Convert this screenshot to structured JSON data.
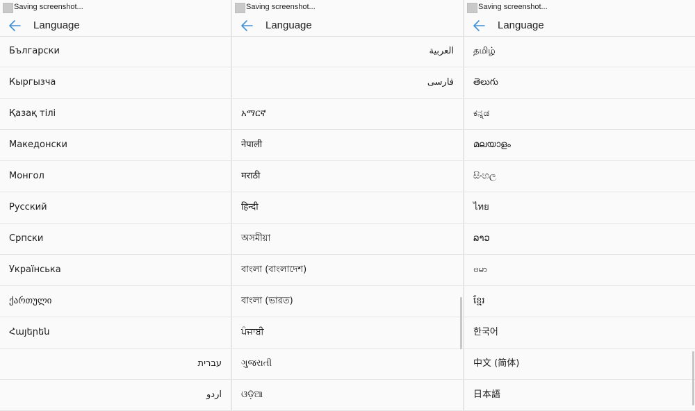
{
  "panels": [
    {
      "status_text": "Saving screenshot...",
      "title": "Language",
      "items": [
        {
          "label": "Български",
          "rtl": false
        },
        {
          "label": "Кыргызча",
          "rtl": false
        },
        {
          "label": "Қазақ тілі",
          "rtl": false
        },
        {
          "label": "Македонски",
          "rtl": false
        },
        {
          "label": "Монгол",
          "rtl": false
        },
        {
          "label": "Русский",
          "rtl": false
        },
        {
          "label": "Српски",
          "rtl": false
        },
        {
          "label": "Українська",
          "rtl": false
        },
        {
          "label": "ქართული",
          "rtl": false
        },
        {
          "label": "Հայերեն",
          "rtl": false
        },
        {
          "label": "עברית",
          "rtl": true
        },
        {
          "label": "اردو",
          "rtl": true
        }
      ]
    },
    {
      "status_text": "Saving screenshot...",
      "title": "Language",
      "items": [
        {
          "label": "العربية",
          "rtl": true
        },
        {
          "label": "فارسی",
          "rtl": true
        },
        {
          "label": "አማርኛ",
          "rtl": false
        },
        {
          "label": "नेपाली",
          "rtl": false
        },
        {
          "label": "मराठी",
          "rtl": false
        },
        {
          "label": "हिन्दी",
          "rtl": false
        },
        {
          "label": "অসমীয়া",
          "rtl": false
        },
        {
          "label": "বাংলা (বাংলাদেশ)",
          "rtl": false
        },
        {
          "label": "বাংলা (ভারত)",
          "rtl": false
        },
        {
          "label": "ਪੰਜਾਬੀ",
          "rtl": false
        },
        {
          "label": "ગુજરાતી",
          "rtl": false
        },
        {
          "label": "ଓଡ଼ିଆ",
          "rtl": false
        }
      ]
    },
    {
      "status_text": "Saving screenshot...",
      "title": "Language",
      "items": [
        {
          "label": "தமிழ்",
          "rtl": false
        },
        {
          "label": "తెలుగు",
          "rtl": false
        },
        {
          "label": "ಕನ್ನಡ",
          "rtl": false
        },
        {
          "label": "മലയാളം",
          "rtl": false
        },
        {
          "label": "සිංහල",
          "rtl": false
        },
        {
          "label": "ไทย",
          "rtl": false
        },
        {
          "label": "ລາວ",
          "rtl": false
        },
        {
          "label": "ဗမာ",
          "rtl": false
        },
        {
          "label": "ខ្មែរ",
          "rtl": false
        },
        {
          "label": "한국어",
          "rtl": false
        },
        {
          "label": "中文 (简体)",
          "rtl": false
        },
        {
          "label": "日本語",
          "rtl": false
        }
      ]
    }
  ],
  "icons": {
    "back": "arrow-left-icon",
    "status": "screenshot-thumbnail-icon"
  },
  "colors": {
    "accent": "#3f8fd8",
    "background": "#fafafa",
    "divider": "#e5e5e5",
    "text": "#1a1a1a"
  }
}
